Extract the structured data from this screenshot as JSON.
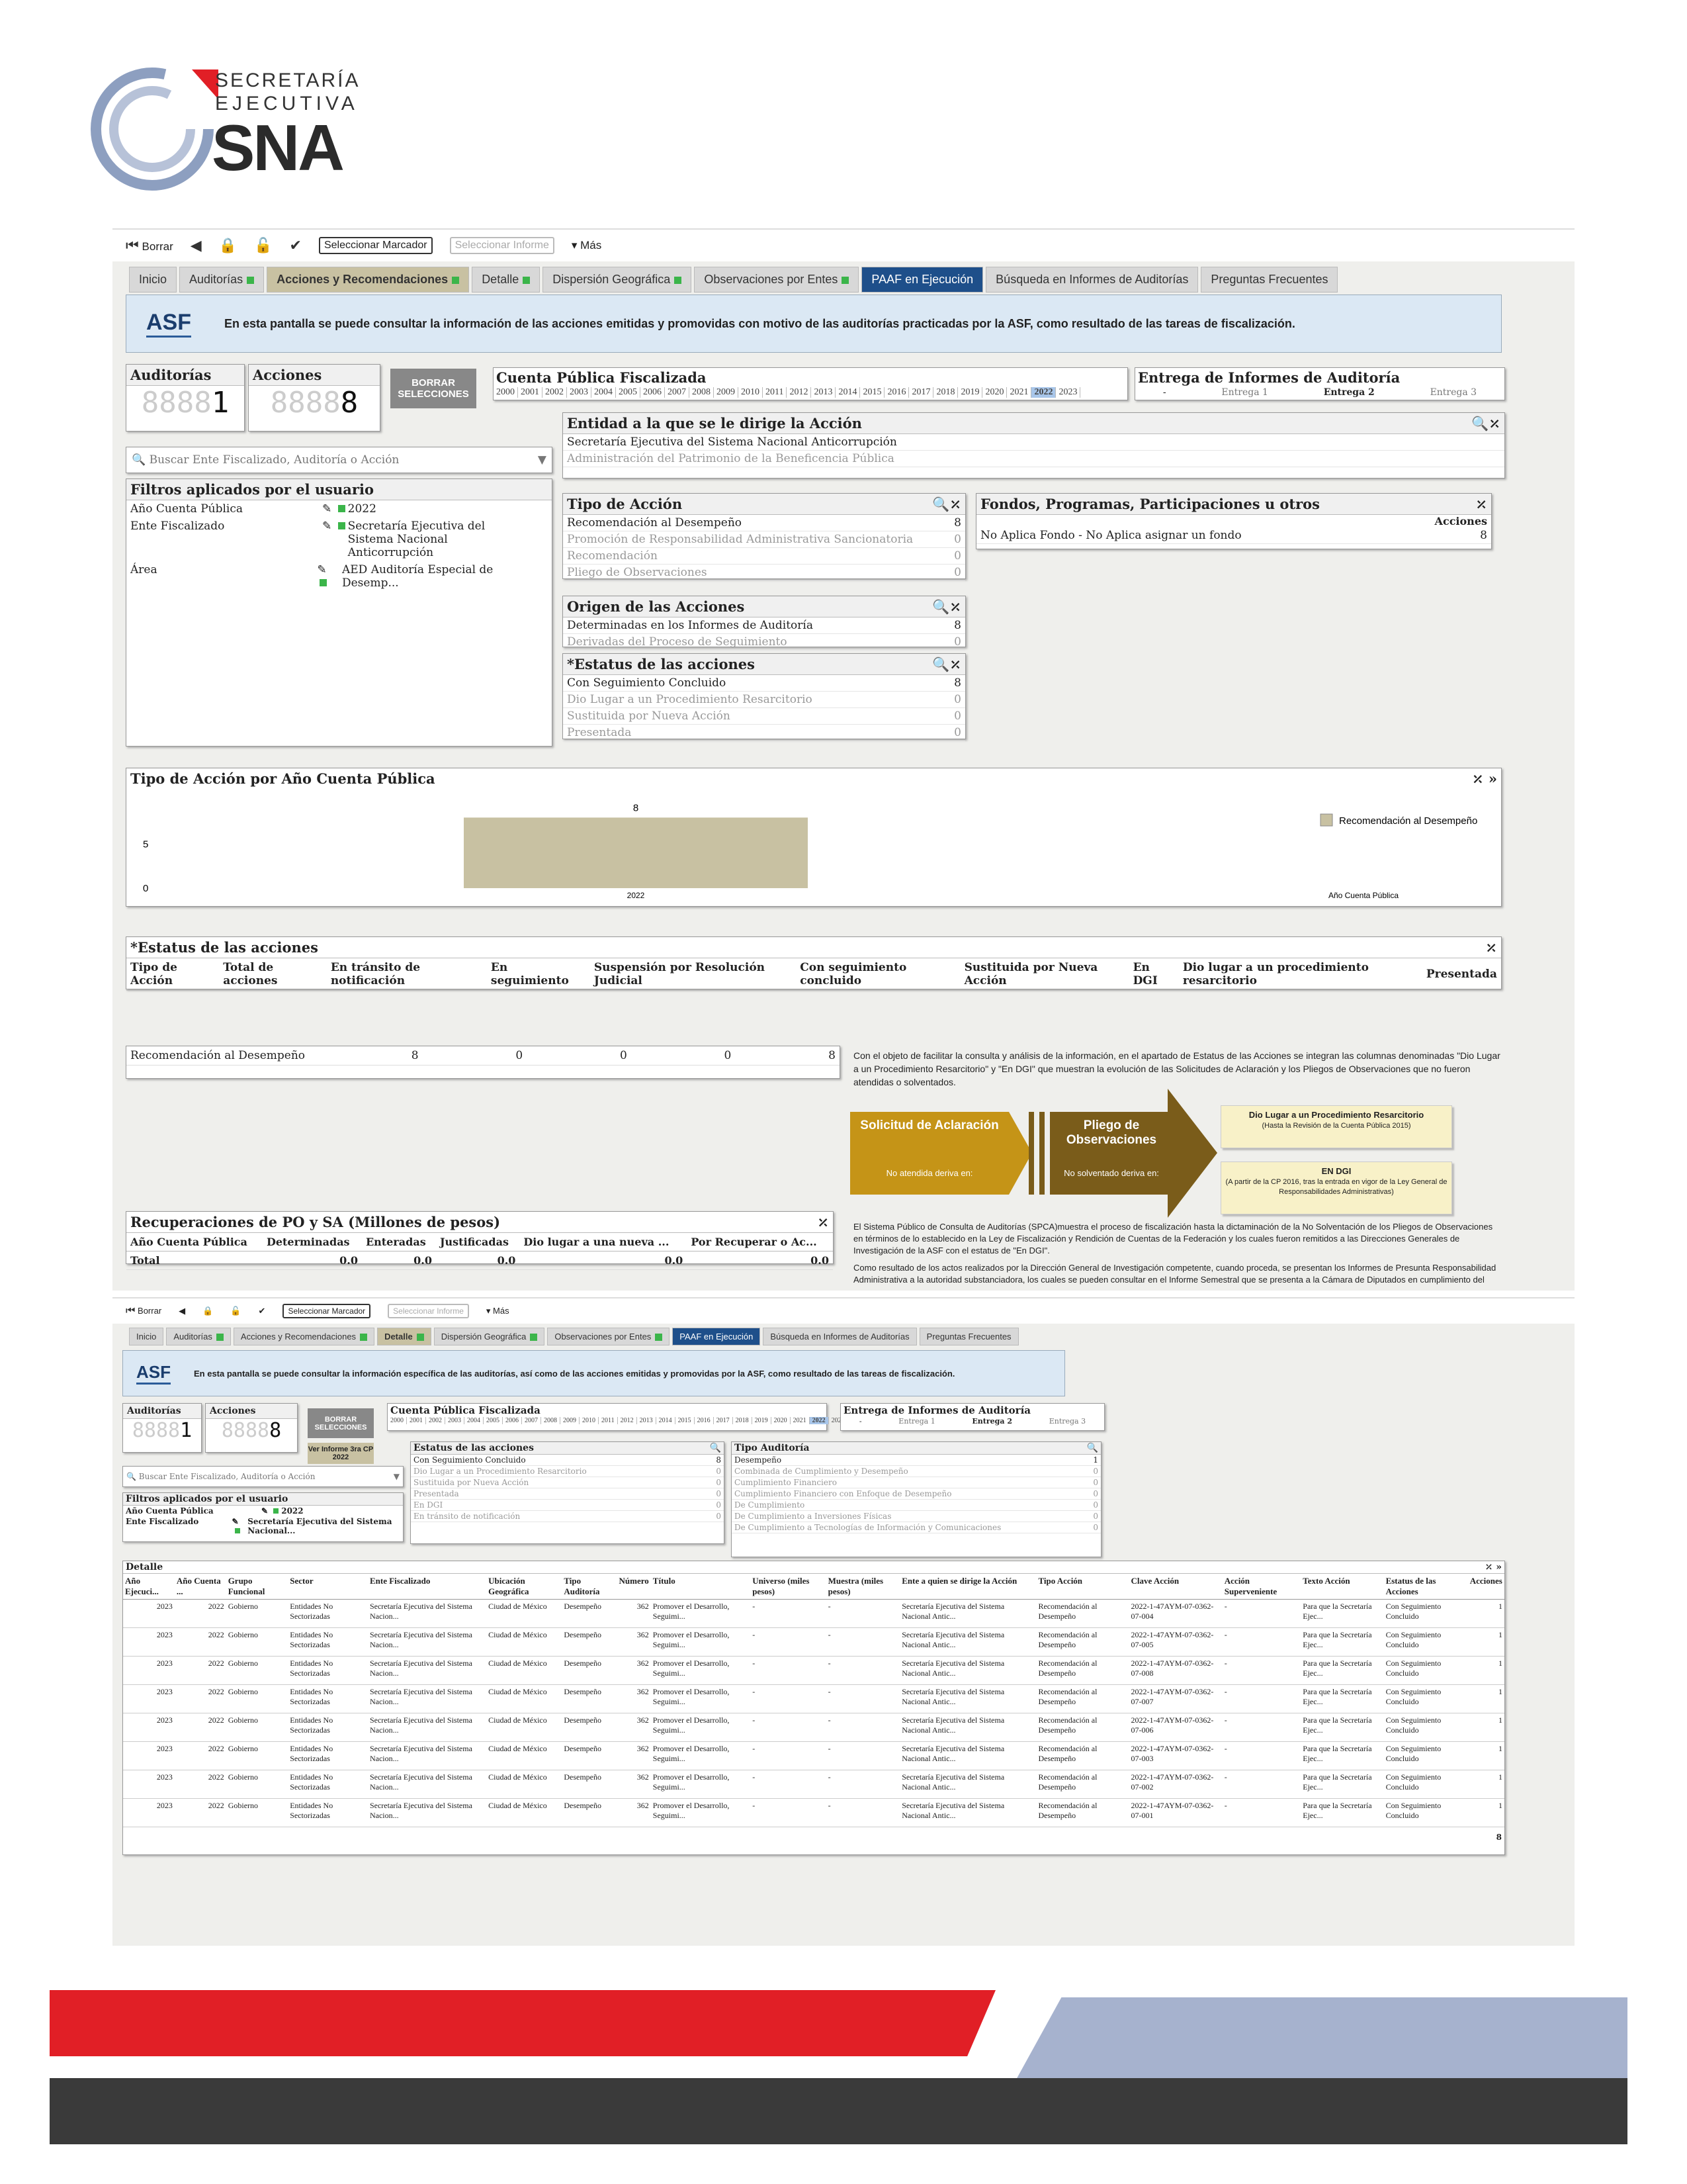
{
  "logo": {
    "line1": "SECRETARÍA",
    "line2": "EJECUTIVA",
    "line3": "SNA"
  },
  "toolbar": {
    "borrar": "Borrar",
    "marcador": "Seleccionar Marcador",
    "informe": "Seleccionar Informe",
    "mas": "Más"
  },
  "tabs1": [
    {
      "label": "Inicio"
    },
    {
      "label": "Auditorías"
    },
    {
      "label": "Acciones y Recomendaciones"
    },
    {
      "label": "Detalle"
    },
    {
      "label": "Dispersión Geográfica"
    },
    {
      "label": "Observaciones por Entes"
    },
    {
      "label": "PAAF en Ejecución"
    },
    {
      "label": "Búsqueda en Informes de Auditorías"
    },
    {
      "label": "Preguntas Frecuentes"
    }
  ],
  "banner1": {
    "logo": "ASF",
    "text": "En esta pantalla se puede consultar la información de las acciones emitidas y promovidas con motivo de las auditorías practicadas por la ASF, como resultado de las tareas de fiscalización."
  },
  "counters": {
    "auditorias_label": "Auditorías",
    "auditorias_value": "1",
    "acciones_label": "Acciones",
    "acciones_value": "8",
    "borrar": "BORRAR SELECCIONES"
  },
  "cuenta": {
    "title": "Cuenta Pública Fiscalizada",
    "years": [
      "2000",
      "2001",
      "2002",
      "2003",
      "2004",
      "2005",
      "2006",
      "2007",
      "2008",
      "2009",
      "2010",
      "2011",
      "2012",
      "2013",
      "2014",
      "2015",
      "2016",
      "2017",
      "2018",
      "2019",
      "2020",
      "2021",
      "2022",
      "2023"
    ],
    "selected": "2022"
  },
  "entrega": {
    "title": "Entrega de Informes de Auditoría",
    "items": [
      "-",
      "Entrega 1",
      "Entrega 2",
      "Entrega 3"
    ]
  },
  "entidad": {
    "title": "Entidad a la que se le dirige la Acción",
    "items": [
      "Secretaría Ejecutiva del Sistema Nacional Anticorrupción",
      "Administración del Patrimonio de la Beneficencia Pública"
    ]
  },
  "search": {
    "placeholder": "Buscar Ente Fiscalizado, Auditoría o Acción"
  },
  "filtros": {
    "title": "Filtros aplicados por el usuario",
    "rows": [
      {
        "label": "Año Cuenta Pública",
        "value": "2022"
      },
      {
        "label": "Ente Fiscalizado",
        "value": "Secretaría Ejecutiva del Sistema Nacional Anticorrupción"
      },
      {
        "label": "Área",
        "value": "AED Auditoría Especial de Desemp..."
      }
    ]
  },
  "tipo": {
    "title": "Tipo de Acción",
    "items": [
      {
        "label": "Recomendación al Desempeño",
        "n": "8"
      },
      {
        "label": "Promoción de Responsabilidad Administrativa Sancionatoria",
        "n": "0"
      },
      {
        "label": "Recomendación",
        "n": "0"
      },
      {
        "label": "Pliego de Observaciones",
        "n": "0"
      }
    ]
  },
  "fondos": {
    "title": "Fondos, Programas, Participaciones u otros",
    "col": "Acciones",
    "row": "No Aplica Fondo - No Aplica asignar un fondo",
    "n": "8"
  },
  "origen": {
    "title": "Origen de las Acciones",
    "items": [
      {
        "label": "Determinadas en los Informes de Auditoría",
        "n": "8"
      },
      {
        "label": "Derivadas del Proceso de Seguimiento",
        "n": "0"
      }
    ]
  },
  "estatus": {
    "title": "*Estatus de las acciones",
    "items": [
      {
        "label": "Con Seguimiento Concluido",
        "n": "8"
      },
      {
        "label": "Dio Lugar a un Procedimiento Resarcitorio",
        "n": "0"
      },
      {
        "label": "Sustituida por Nueva Acción",
        "n": "0"
      },
      {
        "label": "Presentada",
        "n": "0"
      }
    ]
  },
  "chart_data": {
    "type": "bar",
    "title": "Tipo de Acción por Año Cuenta Pública",
    "categories": [
      "2022"
    ],
    "series": [
      {
        "name": "Recomendación al Desempeño",
        "values": [
          8
        ]
      }
    ],
    "xlabel": "Año Cuenta Pública",
    "yticks": [
      "0",
      "5"
    ],
    "data_label": "8",
    "color": "#c8c1a2"
  },
  "estatusTbl": {
    "title": "*Estatus de las acciones",
    "headers": [
      "Tipo de Acción",
      "Total de acciones",
      "En tránsito de notificación",
      "En seguimiento",
      "Suspensión por Resolución Judicial",
      "Con seguimiento concluido",
      "Sustituida por Nueva Acción",
      "En DGI",
      "Dio lugar a un procedimiento resarcitorio",
      "Presentada"
    ],
    "row": {
      "label": "Recomendación al Desempeño",
      "vals": [
        "8",
        "0",
        "0",
        "0",
        "8"
      ]
    }
  },
  "note1": "Con el objeto de facilitar la consulta y análisis de la información, en el apartado de Estatus de las Acciones se integran las columnas denominadas \"Dio Lugar a un Procedimiento Resarcitorio\" y \"En DGI\" que muestran la evolución de las Solicitudes de Aclaración y los Pliegos de Observaciones que no fueron atendidas o solventados.",
  "flow": {
    "a1": "Solicitud de Aclaración",
    "a1s": "No atendida deriva en:",
    "a2": "Pliego de Observaciones",
    "a2s": "No solventado deriva en:",
    "y1": "Dio Lugar a un Procedimiento Resarcitorio",
    "y1s": "(Hasta la Revisión de la Cuenta Pública 2015)",
    "y2": "EN DGI",
    "y2s": "(A partir de la CP 2016, tras la entrada en vigor de la Ley General de Responsabilidades Administrativas)"
  },
  "recup": {
    "title": "Recuperaciones de PO y SA (Millones de pesos)",
    "headers": [
      "Año Cuenta Pública",
      "Determinadas",
      "Enteradas",
      "Justificadas",
      "Dio lugar a una nueva ...",
      "Por Recuperar o Ac..."
    ],
    "total": [
      "Total",
      "0.0",
      "0.0",
      "0.0",
      "0.0",
      "0.0"
    ]
  },
  "note2": "El Sistema Público de Consulta de Auditorías (SPCA)muestra el proceso de fiscalización hasta la dictaminación de la No Solventación de los Pliegos de Observaciones en términos de lo establecido en la Ley de Fiscalización y Rendición de Cuentas de la Federación y los cuales fueron remitidos a las Direcciones Generales de Investigación de la ASF con el estatus de \"En DGI\".",
  "note3": "Como resultado de los actos realizados por la Dirección General de Investigación competente, cuando proceda, se presentan los Informes de Presunta Responsabilidad Administrativa a la autoridad substanciadora, los cuales se pueden consultar en el Informe Semestral que se presenta a la Cámara de Diputados en cumplimiento del",
  "banner2": "En esta pantalla se puede consultar la información específica de las auditorías, así como de las acciones emitidas y promovidas por la ASF, como resultado de las tareas de fiscalización.",
  "verInforme": "Ver Informe 3ra CP 2022",
  "estatus2": {
    "title": "Estatus de las acciones",
    "items": [
      {
        "label": "Con Seguimiento Concluido",
        "n": "8"
      },
      {
        "label": "Dio Lugar a un Procedimiento Resarcitorio",
        "n": "0"
      },
      {
        "label": "Sustituida por Nueva Acción",
        "n": "0"
      },
      {
        "label": "Presentada",
        "n": "0"
      },
      {
        "label": "En DGI",
        "n": "0"
      },
      {
        "label": "En tránsito de notificación",
        "n": "0"
      }
    ]
  },
  "tipoAud": {
    "title": "Tipo Auditoría",
    "items": [
      {
        "label": "Desempeño",
        "n": "1"
      },
      {
        "label": "Combinada de Cumplimiento y Desempeño",
        "n": "0"
      },
      {
        "label": "Cumplimiento Financiero",
        "n": "0"
      },
      {
        "label": "Cumplimiento Financiero con Enfoque de Desempeño",
        "n": "0"
      },
      {
        "label": "De Cumplimiento",
        "n": "0"
      },
      {
        "label": "De Cumplimiento a Inversiones Físicas",
        "n": "0"
      },
      {
        "label": "De Cumplimiento a Tecnologías de Información y Comunicaciones",
        "n": "0"
      }
    ]
  },
  "filtros2": {
    "rows": [
      {
        "label": "Año Cuenta Pública",
        "value": "2022"
      },
      {
        "label": "Ente Fiscalizado",
        "value": "Secretaría Ejecutiva del Sistema Nacional..."
      }
    ]
  },
  "detalle": {
    "title": "Detalle",
    "headers": [
      "Año Ejecuci...",
      "Año Cuenta ...",
      "Grupo Funcional",
      "Sector",
      "Ente Fiscalizado",
      "Ubicación Geográfica",
      "Tipo Auditoría",
      "Número",
      "Título",
      "Universo (miles pesos)",
      "Muestra (miles pesos)",
      "Ente a quien se dirige la Acción",
      "Tipo Acción",
      "Clave Acción",
      "Acción Superveniente",
      "Texto Acción",
      "Estatus de las Acciones",
      "Acciones"
    ],
    "rows": [
      {
        "clave": "2022-1-47AYM-07-0362-07-004"
      },
      {
        "clave": "2022-1-47AYM-07-0362-07-005"
      },
      {
        "clave": "2022-1-47AYM-07-0362-07-008"
      },
      {
        "clave": "2022-1-47AYM-07-0362-07-007"
      },
      {
        "clave": "2022-1-47AYM-07-0362-07-006"
      },
      {
        "clave": "2022-1-47AYM-07-0362-07-003"
      },
      {
        "clave": "2022-1-47AYM-07-0362-07-002"
      },
      {
        "clave": "2022-1-47AYM-07-0362-07-001"
      }
    ],
    "common": {
      "anioE": "2023",
      "anioC": "2022",
      "grupo": "Gobierno",
      "sector": "Entidades No Sectorizadas",
      "ente": "Secretaría Ejecutiva del Sistema Nacion...",
      "ubic": "Ciudad de México",
      "tipo": "Desempeño",
      "num": "362",
      "titulo": "Promover el Desarrollo, Seguimi...",
      "univ": "-",
      "muestra": "-",
      "dirige": "Secretaría Ejecutiva del Sistema Nacional Antic...",
      "tipoAcc": "Recomendación al Desempeño",
      "superv": "-",
      "texto": "Para que la Secretaría Ejec...",
      "estatus": "Con Seguimiento Concluido",
      "acciones": "1"
    },
    "total": "8"
  }
}
